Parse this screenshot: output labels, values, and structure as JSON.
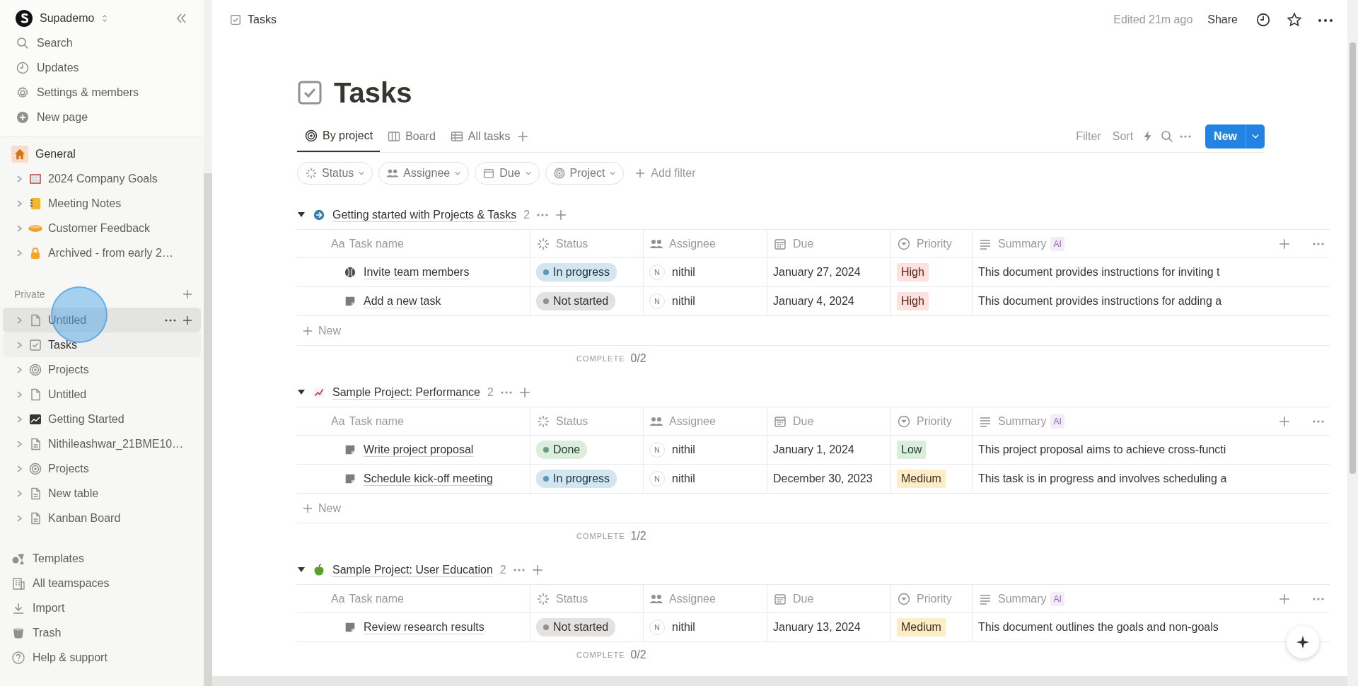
{
  "sidebar": {
    "workspace": "Supademo",
    "nav": [
      "Search",
      "Updates",
      "Settings & members",
      "New page"
    ],
    "teamspace": {
      "label": "General",
      "pages": [
        "2024 Company Goals",
        "Meeting Notes",
        "Customer Feedback",
        "Archived - from early 2…"
      ]
    },
    "private": {
      "label": "Private",
      "pages": [
        {
          "label": "Untitled",
          "selected": false,
          "hovered": true
        },
        {
          "label": "Tasks",
          "selected": true,
          "hovered": false
        },
        {
          "label": "Projects",
          "selected": false,
          "hovered": false
        },
        {
          "label": "Untitled",
          "selected": false,
          "hovered": false
        },
        {
          "label": "Getting Started",
          "selected": false,
          "hovered": false
        },
        {
          "label": "Nithileashwar_21BME10…",
          "selected": false,
          "hovered": false
        },
        {
          "label": "Projects",
          "selected": false,
          "hovered": false
        },
        {
          "label": "New table",
          "selected": false,
          "hovered": false
        },
        {
          "label": "Kanban Board",
          "selected": false,
          "hovered": false
        }
      ]
    },
    "footer": [
      "Templates",
      "All teamspaces",
      "Import",
      "Trash",
      "Help & support"
    ]
  },
  "topbar": {
    "breadcrumb": "Tasks",
    "edited": "Edited 21m ago",
    "share": "Share"
  },
  "page": {
    "title": "Tasks",
    "views": [
      {
        "label": "By project",
        "selected": true
      },
      {
        "label": "Board",
        "selected": false
      },
      {
        "label": "All tasks",
        "selected": false
      }
    ],
    "toolbar": [
      "Filter",
      "Sort"
    ],
    "new_button": "New",
    "filters": [
      "Status",
      "Assignee",
      "Due",
      "Project"
    ],
    "add_filter": "Add filter"
  },
  "groups": [
    {
      "title": "Getting started with Projects & Tasks",
      "count": "2",
      "name_prefix": "Aa",
      "columns": [
        "Task name",
        "Status",
        "Assignee",
        "Due",
        "Priority",
        "Summary"
      ],
      "ai_badge": "AI",
      "rows": [
        {
          "name": "Invite team members",
          "status": {
            "label": "In progress",
            "kind": "in_progress"
          },
          "initial": "N",
          "assignee": "nithil",
          "due": "January 27, 2024",
          "priority": {
            "label": "High",
            "kind": "high"
          },
          "summary": "This document provides instructions for inviting t"
        },
        {
          "name": "Add a new task",
          "status": {
            "label": "Not started",
            "kind": "not_started"
          },
          "initial": "N",
          "assignee": "nithil",
          "due": "January 4, 2024",
          "priority": {
            "label": "High",
            "kind": "high"
          },
          "summary": "This document provides instructions for adding a"
        }
      ],
      "new_label": "New",
      "complete_label": "COMPLETE",
      "complete": "0/2"
    },
    {
      "title": "Sample Project: Performance",
      "count": "2",
      "name_prefix": "Aa",
      "columns": [
        "Task name",
        "Status",
        "Assignee",
        "Due",
        "Priority",
        "Summary"
      ],
      "ai_badge": "AI",
      "rows": [
        {
          "name": "Write project proposal",
          "status": {
            "label": "Done",
            "kind": "done"
          },
          "initial": "N",
          "assignee": "nithil",
          "due": "January 1, 2024",
          "priority": {
            "label": "Low",
            "kind": "low"
          },
          "summary": "This project proposal aims to achieve cross-functi"
        },
        {
          "name": "Schedule kick-off meeting",
          "status": {
            "label": "In progress",
            "kind": "in_progress"
          },
          "initial": "N",
          "assignee": "nithil",
          "due": "December 30, 2023",
          "priority": {
            "label": "Medium",
            "kind": "medium"
          },
          "summary": "This task is in progress and involves scheduling a"
        }
      ],
      "new_label": "New",
      "complete_label": "COMPLETE",
      "complete": "1/2"
    },
    {
      "title": "Sample Project: User Education",
      "count": "2",
      "name_prefix": "Aa",
      "columns": [
        "Task name",
        "Status",
        "Assignee",
        "Due",
        "Priority",
        "Summary"
      ],
      "ai_badge": "AI",
      "rows": [
        {
          "name": "Review research results",
          "status": {
            "label": "Not started",
            "kind": "not_started"
          },
          "initial": "N",
          "assignee": "nithil",
          "due": "January 13, 2024",
          "priority": {
            "label": "Medium",
            "kind": "medium"
          },
          "summary": "This document outlines the goals and non-goals"
        }
      ],
      "complete_label": "COMPLETE",
      "complete": "0/2"
    }
  ]
}
